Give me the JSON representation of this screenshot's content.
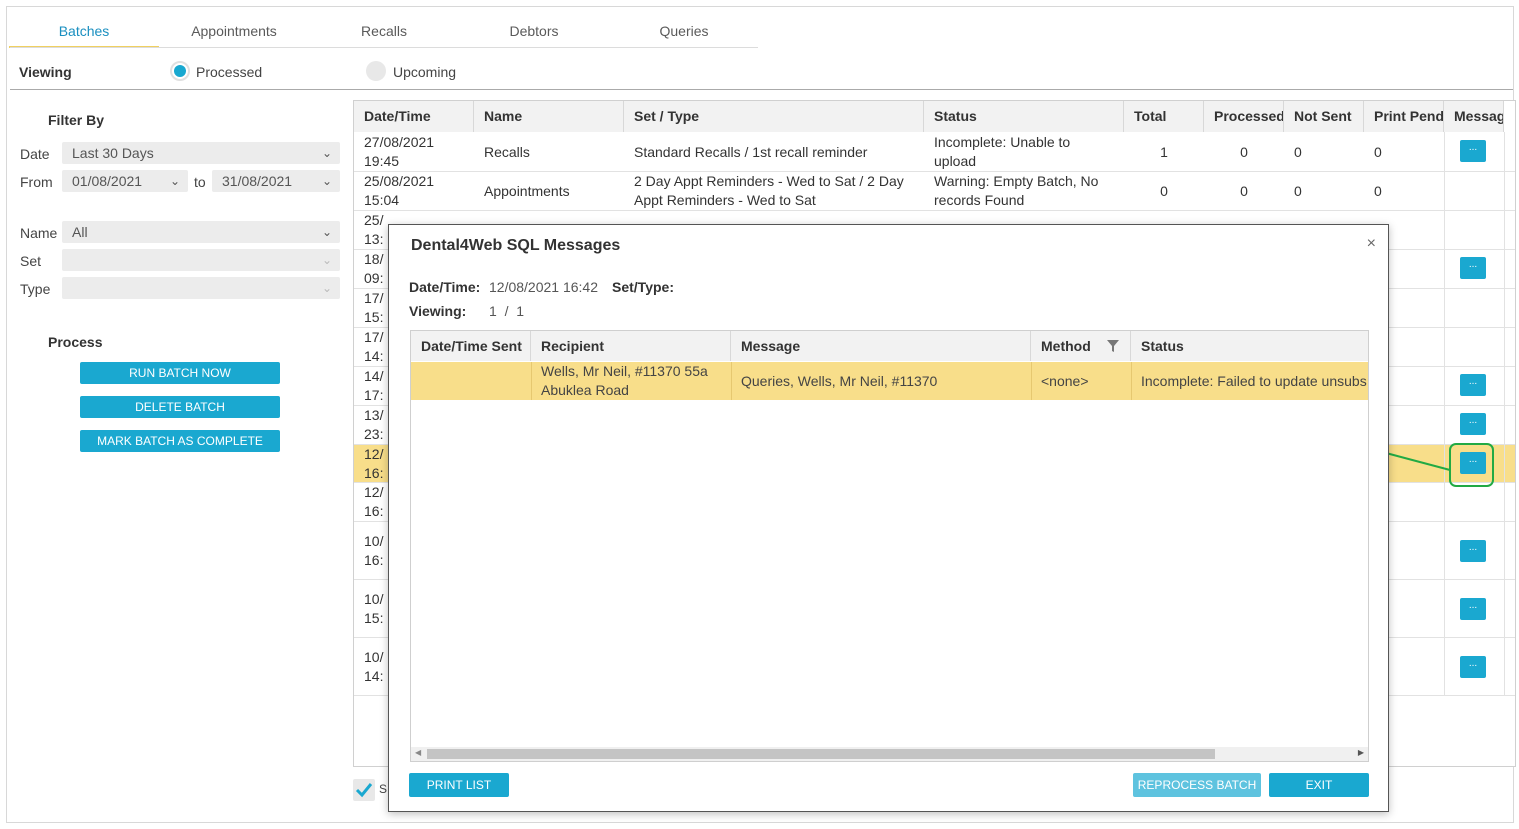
{
  "tabs": [
    "Batches",
    "Appointments",
    "Recalls",
    "Debtors",
    "Queries"
  ],
  "viewing": {
    "label": "Viewing",
    "options": [
      "Processed",
      "Upcoming"
    ],
    "selected": "Processed"
  },
  "filter": {
    "title": "Filter By",
    "date_label": "Date",
    "date_value": "Last 30 Days",
    "from_label": "From",
    "from_value": "01/08/2021",
    "to_label": "to",
    "to_value": "31/08/2021",
    "name_label": "Name",
    "name_value": "All",
    "set_label": "Set",
    "set_value": "",
    "type_label": "Type",
    "type_value": ""
  },
  "process": {
    "title": "Process",
    "run_label": "RUN BATCH NOW",
    "delete_label": "DELETE BATCH",
    "complete_label": "MARK BATCH AS COMPLETE"
  },
  "grid": {
    "columns": [
      "Date/Time",
      "Name",
      "Set / Type",
      "Status",
      "Total",
      "Processed",
      "Not Sent",
      "Print Pendi",
      "Messag"
    ],
    "rows": [
      {
        "d1": "27/08/2021",
        "d2": "19:45",
        "name": "Recalls",
        "set1": "Standard Recalls / 1st recall reminder",
        "set2": "",
        "st1": "Incomplete: Unable to",
        "st2": "upload",
        "total": "1",
        "processed": "0",
        "notsent": "0",
        "print": "0",
        "msg": true
      },
      {
        "d1": "25/08/2021",
        "d2": "15:04",
        "name": "Appointments",
        "set1": "2 Day Appt Reminders - Wed to Sat / 2 Day",
        "set2": "Appt Reminders - Wed to Sat",
        "st1": "Warning: Empty Batch, No",
        "st2": "records Found",
        "total": "0",
        "processed": "0",
        "notsent": "0",
        "print": "0",
        "msg": false
      }
    ],
    "partial_rows": [
      {
        "d1": "25/",
        "d2": "13:",
        "msg": false
      },
      {
        "d1": "18/",
        "d2": "09:",
        "msg": true
      },
      {
        "d1": "17/",
        "d2": "15:",
        "msg": false
      },
      {
        "d1": "17/",
        "d2": "14:",
        "msg": false
      },
      {
        "d1": "14/",
        "d2": "17:",
        "msg": true
      },
      {
        "d1": "13/",
        "d2": "23:",
        "msg": true
      },
      {
        "d1": "12/",
        "d2": "16:",
        "msg": true
      },
      {
        "d1": "12/",
        "d2": "16:",
        "msg": false
      },
      {
        "d1": "10/",
        "d2": "16:",
        "msg": true
      },
      {
        "d1": "10/",
        "d2": "15:",
        "msg": true
      },
      {
        "d1": "10/",
        "d2": "14:",
        "msg": true
      }
    ],
    "msg_button_label": "...",
    "checkbox_partial": "S"
  },
  "modal": {
    "title": "Dental4Web SQL Messages",
    "close": "×",
    "datetime_label": "Date/Time:",
    "datetime_value": "12/08/2021 16:42",
    "settype_label": "Set/Type:",
    "settype_value": "",
    "viewing_label": "Viewing:",
    "viewing_value": "1  /  1",
    "columns": [
      "Date/Time Sent",
      "Recipient",
      "Message",
      "Method",
      "Status"
    ],
    "row": {
      "sent": "",
      "recipient1": "Wells, Mr Neil, #11370 55a",
      "recipient2": "Abuklea Road",
      "message": "Queries, Wells, Mr Neil, #11370",
      "method": "<none>",
      "status": "Incomplete: Failed to update unsubs"
    },
    "print_label": "PRINT LIST",
    "reprocess_label": "REPROCESS BATCH",
    "exit_label": "EXIT"
  },
  "colors": {
    "accent": "#1aa8d0",
    "highlight_row": "#f8de8a",
    "annotation": "#22aa44"
  }
}
